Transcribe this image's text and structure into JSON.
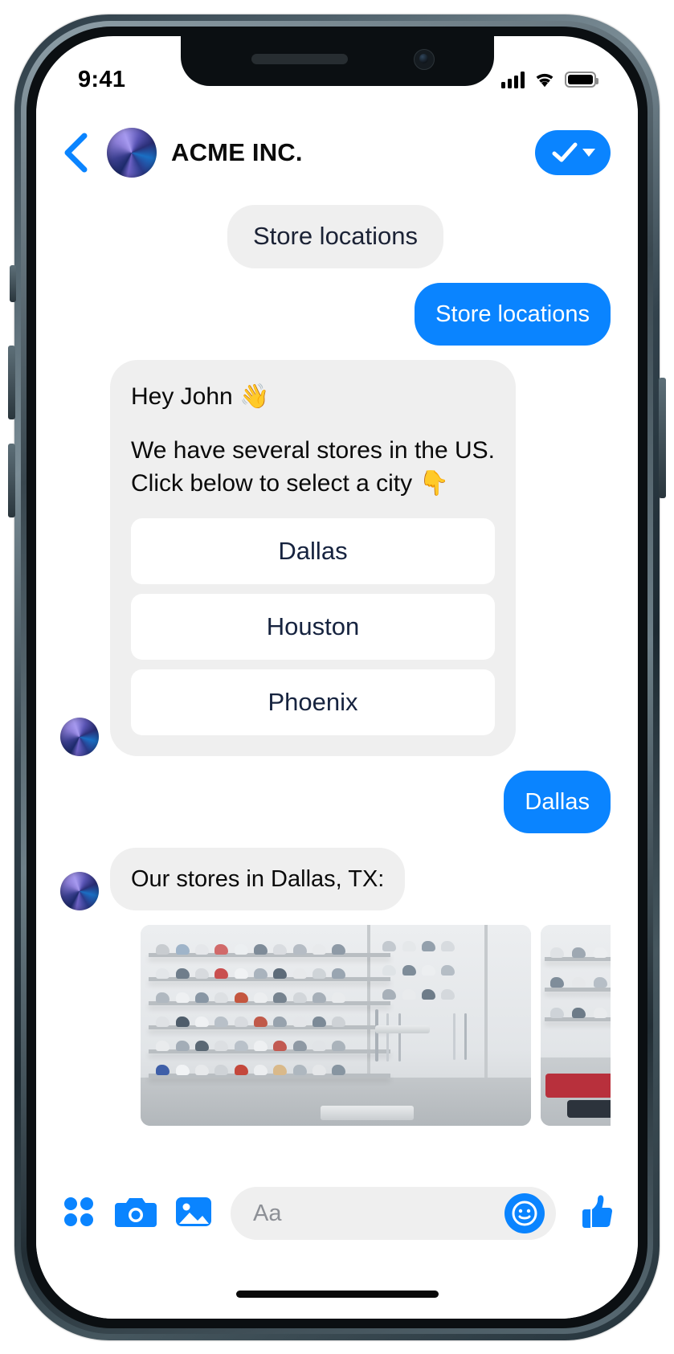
{
  "status_bar": {
    "time": "9:41",
    "signal_icon": "cellular-bars-icon",
    "wifi_icon": "wifi-icon",
    "battery_icon": "battery-full-icon"
  },
  "header": {
    "back_icon": "back-chevron-icon",
    "avatar_icon": "brand-avatar-icon",
    "title": "ACME INC.",
    "verified_button": {
      "check_icon": "checkmark-icon",
      "caret_icon": "chevron-down-icon"
    },
    "accent_color": "#0a84ff"
  },
  "conversation": {
    "messages": [
      {
        "id": "m1",
        "type": "chip",
        "text": "Store locations"
      },
      {
        "id": "m2",
        "type": "out",
        "text": "Store locations"
      },
      {
        "id": "m3",
        "type": "card",
        "greeting": "Hey John 👋",
        "body_line1": "We have several stores in the US.",
        "body_line2": "Click below to select a city 👇",
        "quick_replies": [
          {
            "label": "Dallas"
          },
          {
            "label": "Houston"
          },
          {
            "label": "Phoenix"
          }
        ]
      },
      {
        "id": "m4",
        "type": "out",
        "text": "Dallas"
      },
      {
        "id": "m5",
        "type": "in",
        "text": "Our stores in Dallas, TX:"
      }
    ],
    "carousel": {
      "items": [
        {
          "alt": "sneaker-store-interior-wide"
        },
        {
          "alt": "sneaker-store-interior-second"
        }
      ]
    }
  },
  "composer": {
    "apps_icon": "apps-grid-icon",
    "camera_icon": "camera-icon",
    "gallery_icon": "photo-gallery-icon",
    "input_placeholder": "Aa",
    "emoji_icon": "smiley-icon",
    "like_icon": "thumbs-up-icon"
  },
  "colors": {
    "bubble_them": "#efefef",
    "bubble_me": "#0a84ff",
    "quick_reply_text": "#16233f"
  }
}
